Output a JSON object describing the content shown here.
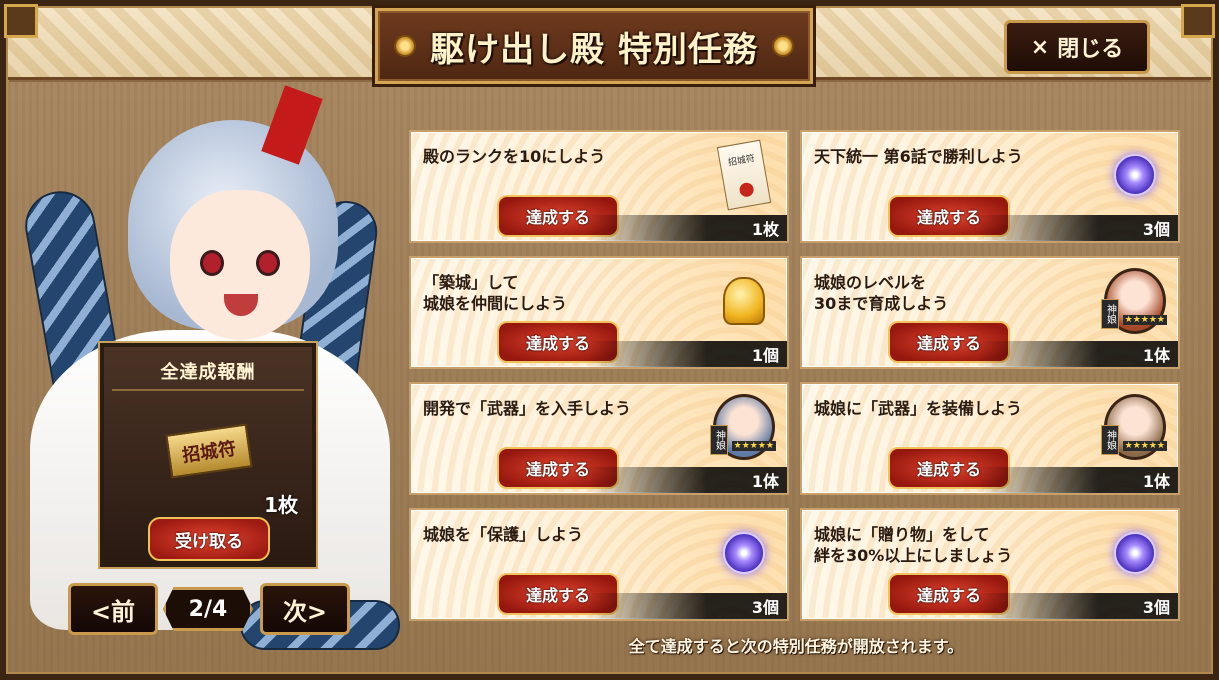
{
  "header": {
    "title": "駆け出し殿 特別任務",
    "close_label": "閉じる",
    "close_icon": "×"
  },
  "reward": {
    "header": "全達成報酬",
    "item_name": "招城符",
    "count": "1枚",
    "receive_label": "受け取る"
  },
  "pager": {
    "prev_label": "<前",
    "next_label": "次>",
    "page": "2/4"
  },
  "missions": [
    {
      "text": "殿のランクを10にしよう",
      "button": "達成する",
      "count": "1枚",
      "icon": "ticket-icon"
    },
    {
      "text": "天下統一 第6話で勝利しよう",
      "button": "達成する",
      "count": "3個",
      "icon": "orb-icon"
    },
    {
      "text": "「築城」して\n城娘を仲間にしよう",
      "button": "達成する",
      "count": "1個",
      "icon": "bell-icon"
    },
    {
      "text": "城娘のレベルを\n30まで育成しよう",
      "button": "達成する",
      "count": "1体",
      "icon": "character-portrait-icon"
    },
    {
      "text": "開発で「武器」を入手しよう",
      "button": "達成する",
      "count": "1体",
      "icon": "character-portrait-icon"
    },
    {
      "text": "城娘に「武器」を装備しよう",
      "button": "達成する",
      "count": "1体",
      "icon": "character-portrait-icon"
    },
    {
      "text": "城娘を「保護」しよう",
      "button": "達成する",
      "count": "3個",
      "icon": "orb-icon"
    },
    {
      "text": "城娘に「贈り物」をして\n絆を30%以上にしましょう",
      "button": "達成する",
      "count": "3個",
      "icon": "orb-icon"
    }
  ],
  "portrait_tag": "神娘",
  "portrait_stars": "★★★★★",
  "ticket_text": "招城符",
  "footer_note": "全て達成すると次の特別任務が開放されます。"
}
